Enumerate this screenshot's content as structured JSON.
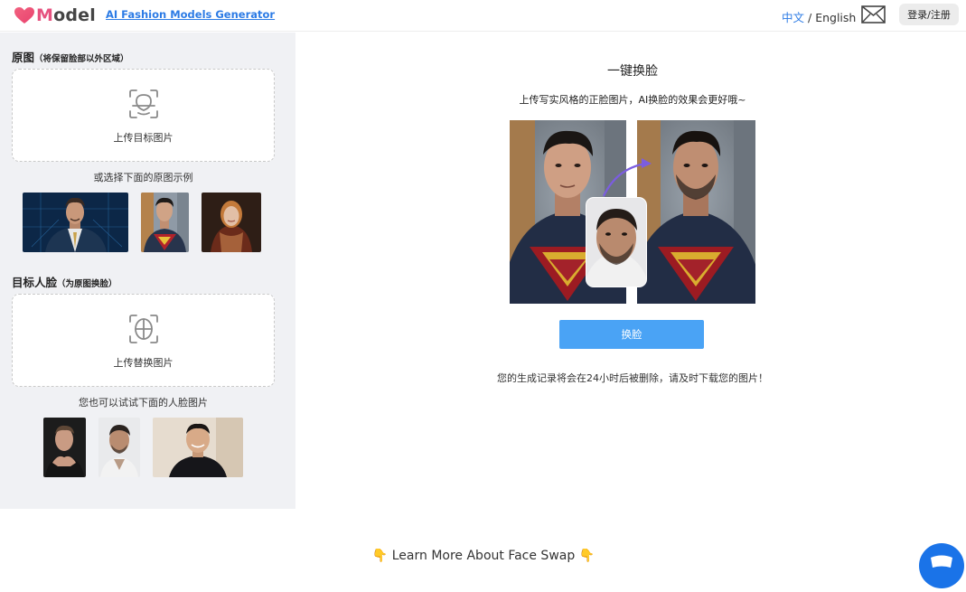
{
  "header": {
    "logo_text_m": "M",
    "logo_text_rest": "odel",
    "brand_link": "AI Fashion Models Generator",
    "lang_zh": "中文",
    "lang_sep": " / ",
    "lang_en": "English",
    "login_button": "登录/注册"
  },
  "left": {
    "source": {
      "title": "原图",
      "title_note": "（将保留脸部以外区域）",
      "upload_label": "上传目标图片",
      "upload_icon": "face-scan-icon",
      "examples_hint": "或选择下面的原图示例"
    },
    "target": {
      "title": "目标人脸",
      "title_note": "（为原图换脸）",
      "upload_label": "上传替换图片",
      "upload_icon": "face-grid-icon",
      "examples_hint": "您也可以试试下面的人脸图片"
    }
  },
  "main": {
    "title": "一键换脸",
    "subtitle": "上传写实风格的正脸图片，AI换脸的效果会更好哦~",
    "swap_button": "换脸",
    "notice": "您的生成记录将会在24小时后被删除，请及时下载您的图片！"
  },
  "footer": {
    "learn_more": "👇 Learn More About Face Swap 👇"
  },
  "colors": {
    "accent": "#2c7be5",
    "button": "#4aa3f5",
    "panel_bg": "#f0f1f4",
    "logo_heart": "#e6527f"
  }
}
